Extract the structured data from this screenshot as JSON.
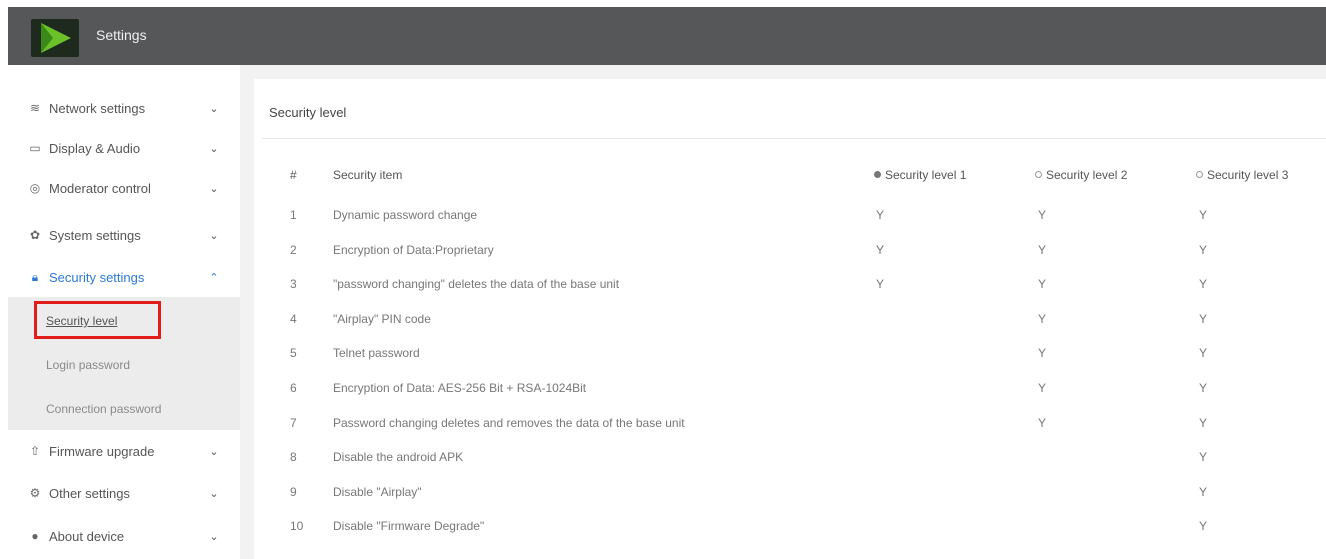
{
  "app": {
    "title": "Settings"
  },
  "sidebar": {
    "items": [
      {
        "label": "Network settings",
        "icon": "wifi-icon"
      },
      {
        "label": "Display & Audio",
        "icon": "monitor-icon"
      },
      {
        "label": "Moderator control",
        "icon": "moderator-icon"
      },
      {
        "label": "System settings",
        "icon": "gear-icon"
      },
      {
        "label": "Security settings",
        "icon": "lock-icon",
        "expanded": true
      },
      {
        "label": "Firmware upgrade",
        "icon": "upload-icon"
      },
      {
        "label": "Other settings",
        "icon": "settings-icon"
      },
      {
        "label": "About device",
        "icon": "info-icon"
      }
    ],
    "submenu": [
      {
        "label": "Security level",
        "current": true
      },
      {
        "label": "Login password"
      },
      {
        "label": "Connection password"
      }
    ]
  },
  "main": {
    "title": "Security level",
    "table": {
      "headers": [
        "#",
        "Security item",
        "Security level 1",
        "Security level 2",
        "Security level 3"
      ],
      "selected_level": "Security level 1",
      "rows": [
        {
          "num": "1",
          "item": "Dynamic password change",
          "l1": "Y",
          "l2": "Y",
          "l3": "Y"
        },
        {
          "num": "2",
          "item": "Encryption of Data:Proprietary",
          "l1": "Y",
          "l2": "Y",
          "l3": "Y"
        },
        {
          "num": "3",
          "item": "\"password changing\" deletes the data of the base unit",
          "l1": "Y",
          "l2": "Y",
          "l3": "Y"
        },
        {
          "num": "4",
          "item": "\"Airplay\" PIN code",
          "l1": "",
          "l2": "Y",
          "l3": "Y"
        },
        {
          "num": "5",
          "item": "Telnet password",
          "l1": "",
          "l2": "Y",
          "l3": "Y"
        },
        {
          "num": "6",
          "item": "Encryption of Data: AES-256 Bit + RSA-1024Bit",
          "l1": "",
          "l2": "Y",
          "l3": "Y"
        },
        {
          "num": "7",
          "item": "Password changing deletes and removes the data of the base unit",
          "l1": "",
          "l2": "Y",
          "l3": "Y"
        },
        {
          "num": "8",
          "item": "Disable the android APK",
          "l1": "",
          "l2": "",
          "l3": "Y"
        },
        {
          "num": "9",
          "item": "Disable \"Airplay\"",
          "l1": "",
          "l2": "",
          "l3": "Y"
        },
        {
          "num": "10",
          "item": "Disable \"Firmware Degrade\"",
          "l1": "",
          "l2": "",
          "l3": "Y"
        }
      ]
    }
  },
  "colors": {
    "topbar": "#555759",
    "accent": "#2d7ad6",
    "highlight": "#e21b1b",
    "logo": "#6cc02a"
  }
}
